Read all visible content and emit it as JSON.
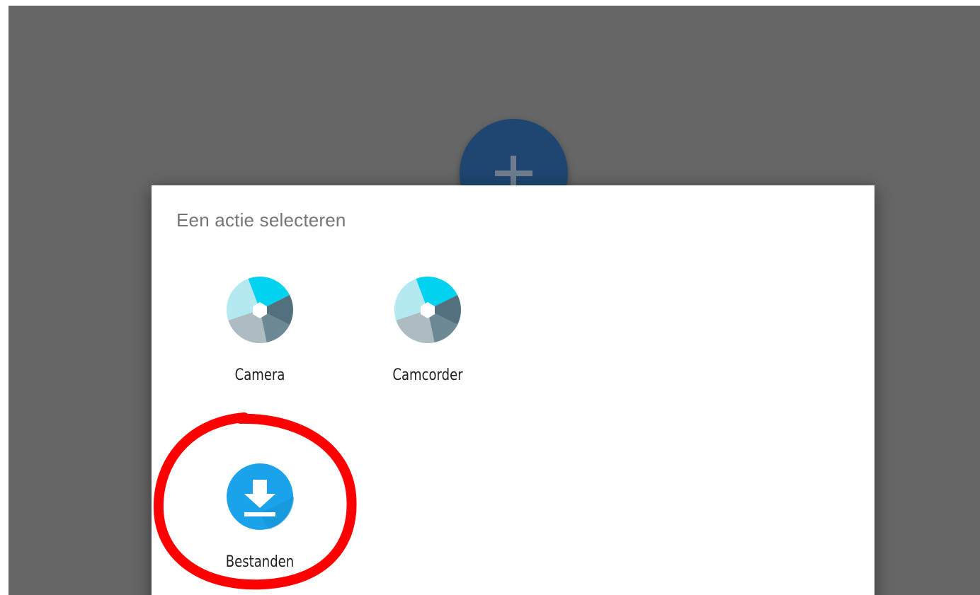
{
  "dialog": {
    "title": "Een actie selecteren",
    "apps": [
      {
        "label": "Camera",
        "icon": "camera-aperture-icon"
      },
      {
        "label": "Camcorder",
        "icon": "camera-aperture-icon"
      },
      {
        "label": "Bestanden",
        "icon": "download-icon"
      }
    ]
  },
  "fab": {
    "icon": "plus-icon",
    "color": "#1f4670"
  },
  "colors": {
    "backdrop": "#666666",
    "dialog_bg": "#ffffff",
    "highlight": "#ff0000",
    "files_icon": "#1aa3ea"
  }
}
